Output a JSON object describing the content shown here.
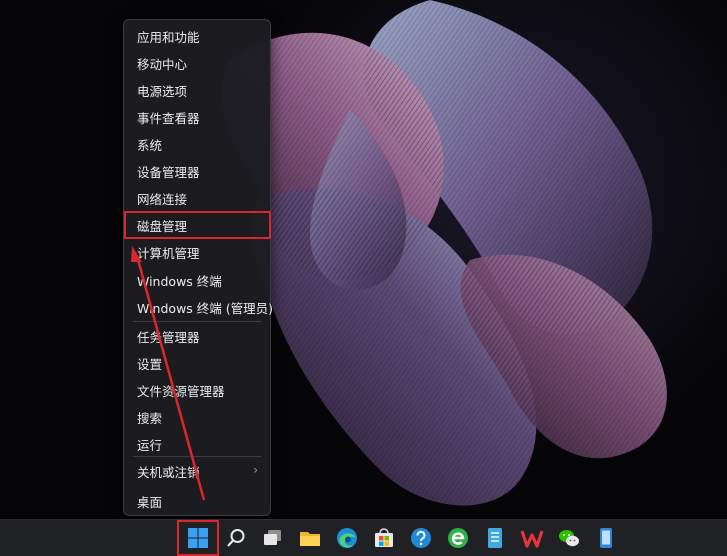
{
  "context_menu": {
    "items": [
      {
        "label": "应用和功能"
      },
      {
        "label": "移动中心"
      },
      {
        "label": "电源选项"
      },
      {
        "label": "事件查看器"
      },
      {
        "label": "系统"
      },
      {
        "label": "设备管理器"
      },
      {
        "label": "网络连接"
      },
      {
        "label": "磁盘管理",
        "highlighted": true
      },
      {
        "label": "计算机管理"
      },
      {
        "label": "Windows 终端"
      },
      {
        "label": "Windows 终端 (管理员)"
      },
      {
        "label": "任务管理器"
      },
      {
        "label": "设置"
      },
      {
        "label": "文件资源管理器"
      },
      {
        "label": "搜索"
      },
      {
        "label": "运行"
      },
      {
        "label": "关机或注销",
        "submenu_glyph": "›"
      },
      {
        "label": "桌面"
      }
    ]
  },
  "taskbar": {
    "icons": [
      "windows-start-icon",
      "search-icon",
      "task-view-icon",
      "file-explorer-icon",
      "edge-browser-icon",
      "microsoft-store-icon",
      "help-icon",
      "green-e-browser-icon",
      "notepad-icon",
      "wps-office-icon",
      "wechat-icon",
      "phone-link-icon"
    ]
  },
  "colors": {
    "highlight_red": "#d9272e",
    "menu_background": "#1c1c21",
    "taskbar_background": "#202124"
  }
}
